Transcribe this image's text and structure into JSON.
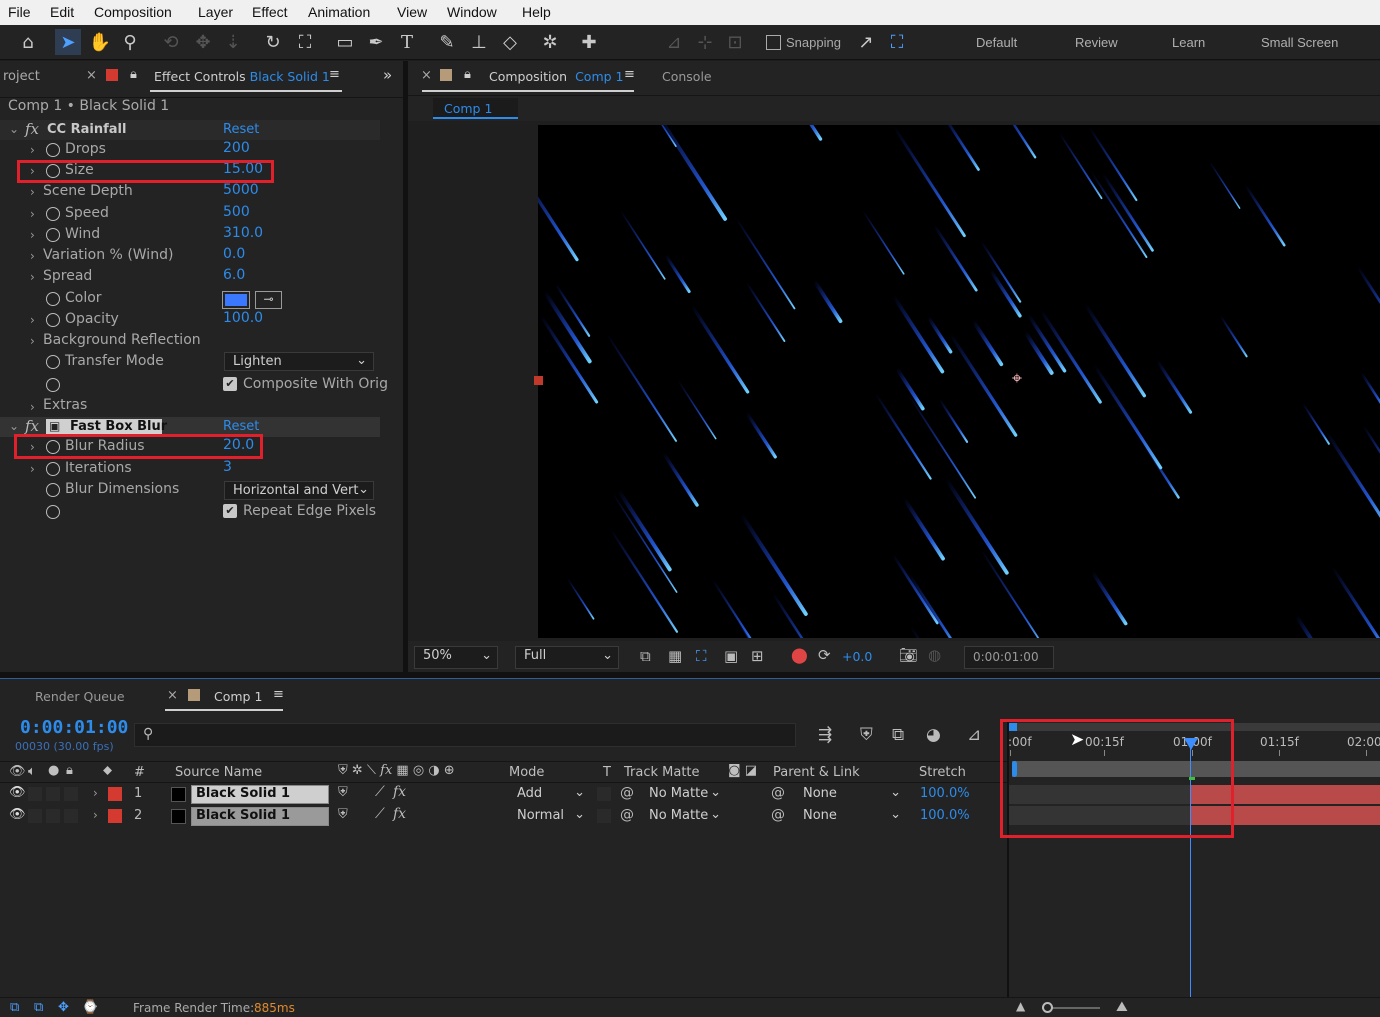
{
  "menu": [
    "File",
    "Edit",
    "Composition",
    "Layer",
    "Effect",
    "Animation",
    "View",
    "Window",
    "Help"
  ],
  "toolbar": {
    "snapping": "Snapping",
    "workspaces": [
      "Default",
      "Review",
      "Learn",
      "Small Screen"
    ]
  },
  "effect_panel": {
    "project_tab": "roject",
    "tab_label": "Effect Controls",
    "tab_layer": "Black Solid 1",
    "breadcrumb": "Comp 1 • Black Solid 1",
    "fx1": {
      "fx": "fx",
      "name": "CC Rainfall",
      "reset": "Reset"
    },
    "params": [
      {
        "label": "Drops",
        "value": "200"
      },
      {
        "label": "Size",
        "value": "15.00"
      },
      {
        "label": "Scene Depth",
        "value": "5000"
      },
      {
        "label": "Speed",
        "value": "500"
      },
      {
        "label": "Wind",
        "value": "310.0"
      },
      {
        "label": "Variation % (Wind)",
        "value": "0.0"
      },
      {
        "label": "Spread",
        "value": "6.0"
      },
      {
        "label": "Color",
        "value": ""
      },
      {
        "label": "Opacity",
        "value": "100.0"
      },
      {
        "label": "Background Reflection",
        "value": ""
      },
      {
        "label": "Transfer Mode",
        "value": ""
      }
    ],
    "transfer_mode": "Lighten",
    "composite": "Composite With Orig",
    "extras": "Extras",
    "rain_color": "#3a78ff",
    "fx2": {
      "fx": "fx",
      "name": "Fast Box Blur",
      "reset": "Reset"
    },
    "blur": [
      {
        "label": "Blur Radius",
        "value": "20.0"
      },
      {
        "label": "Iterations",
        "value": "3"
      },
      {
        "label": "Blur Dimensions",
        "value": ""
      }
    ],
    "blur_dim": "Horizontal and Vert",
    "repeat_edge": "Repeat Edge Pixels"
  },
  "comp_panel": {
    "tab_label": "Composition",
    "tab_comp": "Comp 1",
    "console": "Console",
    "sub_tab": "Comp 1",
    "zoom": "50%",
    "resolution": "Full",
    "exposure": "+0.0",
    "timecode": "0:00:01:00"
  },
  "timeline": {
    "render_queue": "Render Queue",
    "comp_tab": "Comp 1",
    "timecode": "0:00:01:00",
    "fps": "00030 (30.00 fps)",
    "columns": {
      "num": "#",
      "source": "Source Name",
      "mode": "Mode",
      "t": "T",
      "track": "Track Matte",
      "parent": "Parent & Link",
      "stretch": "Stretch"
    },
    "layers": [
      {
        "num": "1",
        "name": "Black Solid 1",
        "mode": "Add",
        "matte": "No Matte",
        "parent": "None",
        "stretch": "100.0%"
      },
      {
        "num": "2",
        "name": "Black Solid 1",
        "mode": "Normal",
        "matte": "No Matte",
        "parent": "None",
        "stretch": "100.0%"
      }
    ],
    "ruler": [
      ":00f",
      "00:15f",
      "01:00f",
      "01:15f",
      "02:00"
    ],
    "frame_time_label": "Frame Render Time:",
    "frame_time": "885ms"
  }
}
